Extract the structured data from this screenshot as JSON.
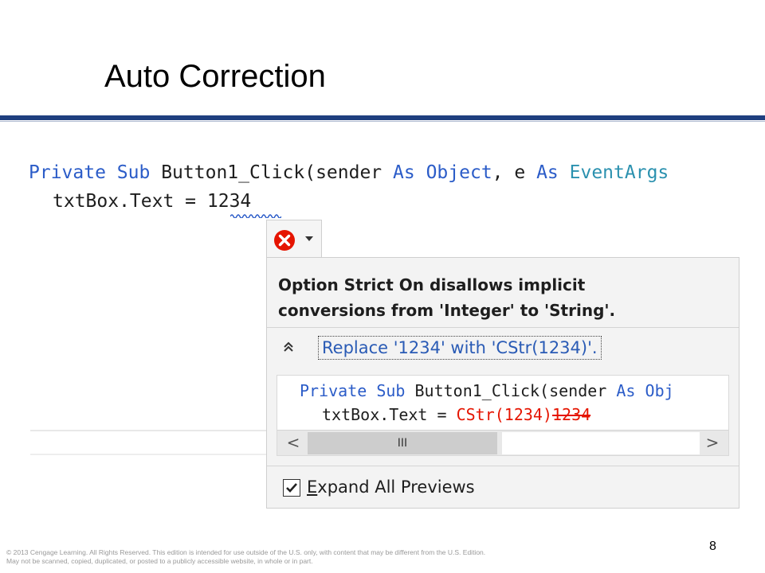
{
  "slide": {
    "title": "Auto Correction",
    "page_number": "8",
    "footer_line1": "© 2013 Cengage Learning. All Rights Reserved. This edition is intended for use outside of the U.S. only, with content that may be different from the U.S. Edition.",
    "footer_line2": "May not be scanned, copied, duplicated, or posted to a publicly accessible website, in whole or in part."
  },
  "editor": {
    "line1": {
      "private": "Private",
      "sub": "Sub",
      "name": "Button1_Click(sender",
      "as1": "As",
      "object": "Object",
      "comma_e": ", e",
      "as2": "As",
      "eventargs": "EventArgs"
    },
    "line2": {
      "text": "txtBox.Text = ",
      "value": "1234"
    }
  },
  "quick_action": {
    "error_icon": "error-circle-icon",
    "dropdown_icon": "chevron-down-icon",
    "message_line1": "Option Strict On disallows implicit",
    "message_line2": "conversions from 'Integer' to 'String'.",
    "collapse_glyph": "≈",
    "action_label": "Replace '1234' with 'CStr(1234)'.",
    "preview": {
      "line1_private": "Private",
      "line1_sub": "Sub",
      "line1_name": "Button1_Click(sender",
      "line1_as": "As",
      "line1_obj": "Obj",
      "line2_text": "txtBox.Text = ",
      "line2_new": "CStr(1234)",
      "line2_old": "1234"
    },
    "scrollbar": {
      "left": "<",
      "right": ">",
      "thumb": "III"
    },
    "expand_all_label_first": "E",
    "expand_all_label_rest": "xpand All Previews",
    "expand_all_checked": true
  },
  "colors": {
    "keyword": "#2b5cc8",
    "type": "#2b91af",
    "error": "#e51400",
    "title_rule": "#1f3f7f"
  }
}
